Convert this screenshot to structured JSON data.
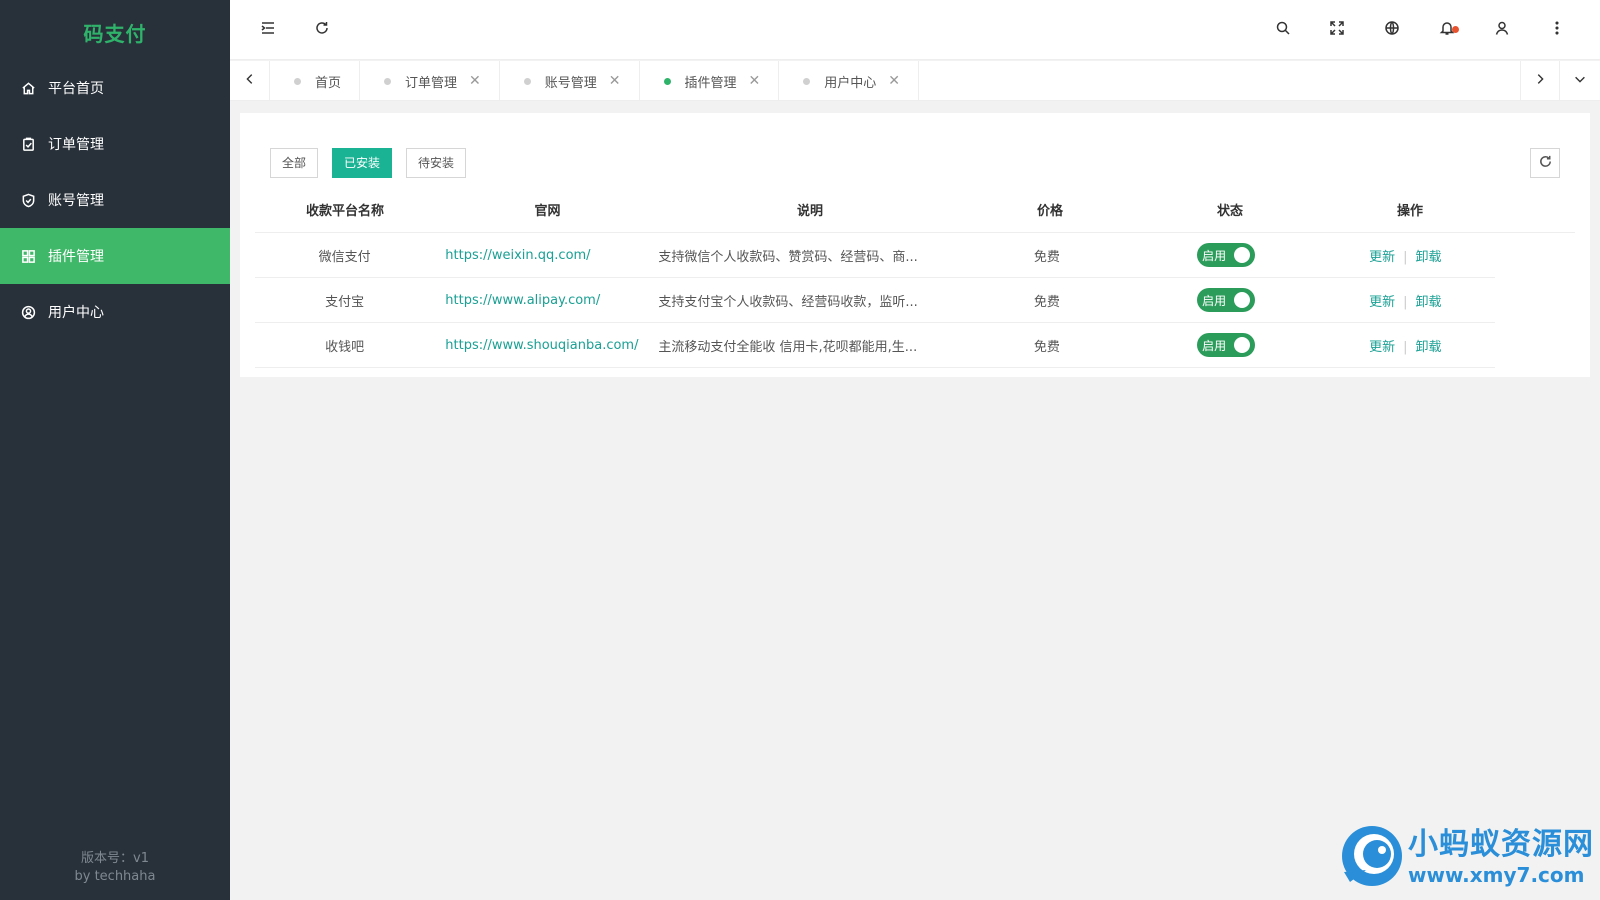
{
  "app": {
    "logo": "码支付"
  },
  "sidebar": {
    "items": [
      {
        "label": "平台首页",
        "icon": "home-icon",
        "active": false
      },
      {
        "label": "订单管理",
        "icon": "clipboard-icon",
        "active": false
      },
      {
        "label": "账号管理",
        "icon": "shield-icon",
        "active": false
      },
      {
        "label": "插件管理",
        "icon": "grid-icon",
        "active": true
      },
      {
        "label": "用户中心",
        "icon": "user-circle-icon",
        "active": false
      }
    ],
    "footer": {
      "version": "版本号：v1",
      "author": "by techhaha"
    }
  },
  "header": {
    "icons": [
      "menu-fold-icon",
      "refresh-icon",
      "search-icon",
      "fullscreen-icon",
      "globe-icon",
      "bell-icon",
      "user-icon",
      "more-icon"
    ],
    "accent_notify": "#e8532f"
  },
  "tabs": [
    {
      "label": "首页",
      "closable": false,
      "active": false
    },
    {
      "label": "订单管理",
      "closable": true,
      "active": false
    },
    {
      "label": "账号管理",
      "closable": true,
      "active": false
    },
    {
      "label": "插件管理",
      "closable": true,
      "active": true
    },
    {
      "label": "用户中心",
      "closable": true,
      "active": false
    }
  ],
  "tab_close_symbol": "✕",
  "filters": {
    "all": "全部",
    "installed": "已安装",
    "pending": "待安装",
    "selected": "已安装"
  },
  "table": {
    "headers": [
      "收款平台名称",
      "官网",
      "说明",
      "价格",
      "状态",
      "操作"
    ],
    "rows": [
      {
        "name": "微信支付",
        "url": "https://weixin.qq.com/",
        "desc": "支持微信个人收款码、赞赏码、经营码、商...",
        "price": "免费",
        "status": "启用",
        "op_update": "更新",
        "op_uninstall": "卸载"
      },
      {
        "name": "支付宝",
        "url": "https://www.alipay.com/",
        "desc": "支持支付宝个人收款码、经营码收款，监听...",
        "price": "免费",
        "status": "启用",
        "op_update": "更新",
        "op_uninstall": "卸载"
      },
      {
        "name": "收钱吧",
        "url": "https://www.shouqianba.com/",
        "desc": "主流移动支付全能收 信用卡,花呗都能用,生...",
        "price": "免费",
        "status": "启用",
        "op_update": "更新",
        "op_uninstall": "卸载"
      }
    ],
    "separator": "|"
  },
  "watermark": {
    "title": "小蚂蚁资源网",
    "url": "www.xmy7.com"
  },
  "colors": {
    "sidebar_bg": "#28313a",
    "sidebar_active": "#40b869",
    "logo": "#2fb36b",
    "primary_btn": "#1ab394",
    "switch_on": "#2b9c5a",
    "link": "#1aa094"
  }
}
